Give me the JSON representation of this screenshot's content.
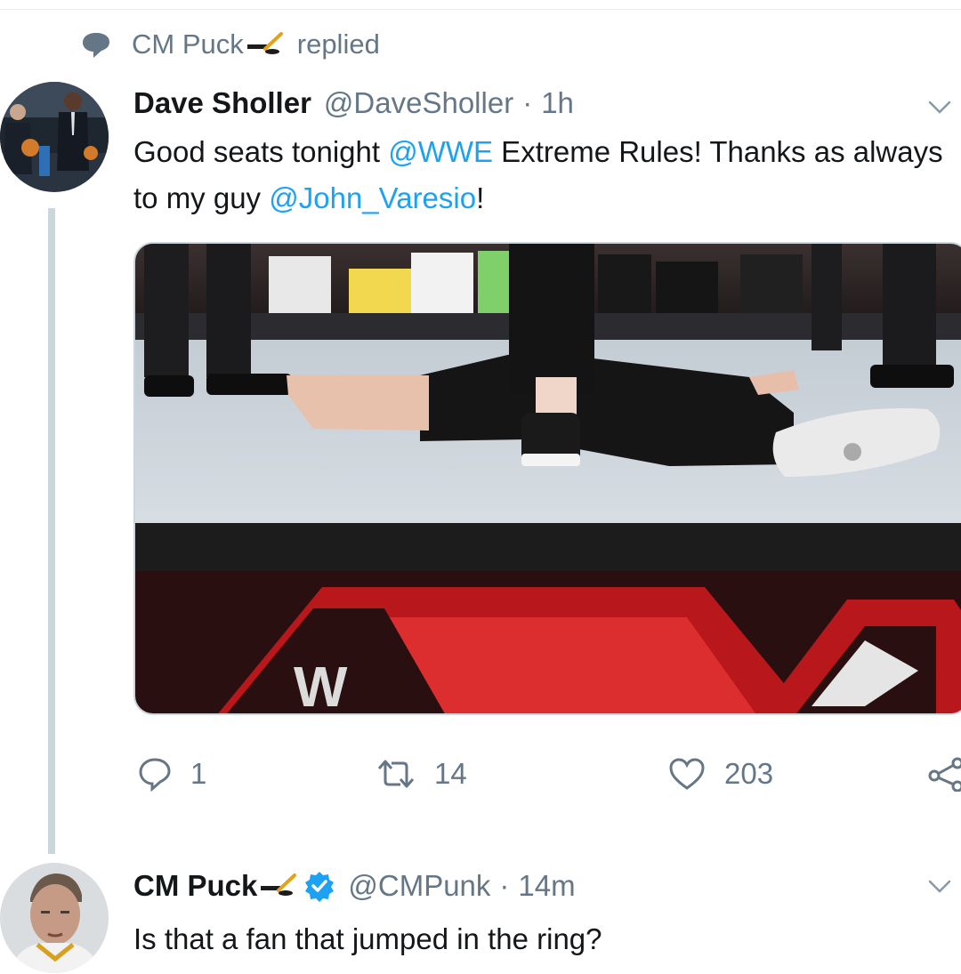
{
  "context": {
    "name": "CM Puck",
    "action": "replied"
  },
  "tweet": {
    "display_name": "Dave Sholler",
    "handle": "@DaveSholler",
    "separator": "·",
    "time": "1h",
    "text_before_1": "Good seats tonight ",
    "mention_1": "@WWE",
    "text_after_1": " Extreme Rules! Thanks as always to my guy ",
    "mention_2": "@John_Varesio",
    "text_after_2": "!",
    "counts": {
      "replies": "1",
      "retweets": "14",
      "likes": "203"
    }
  },
  "reply": {
    "display_name": "CM Puck",
    "handle": "@CMPunk",
    "separator": "·",
    "time": "14m",
    "text": "Is that a fan that jumped in the ring?"
  },
  "colors": {
    "accent": "#1da1f2",
    "muted": "#657786",
    "text": "#14171a",
    "thread_line": "#ccd6dd"
  },
  "icons": [
    "speech-bubble-icon",
    "hockey-stick-emoji",
    "chevron-down-icon",
    "verified-badge-icon",
    "reply-icon",
    "retweet-icon",
    "like-icon",
    "share-icon"
  ]
}
